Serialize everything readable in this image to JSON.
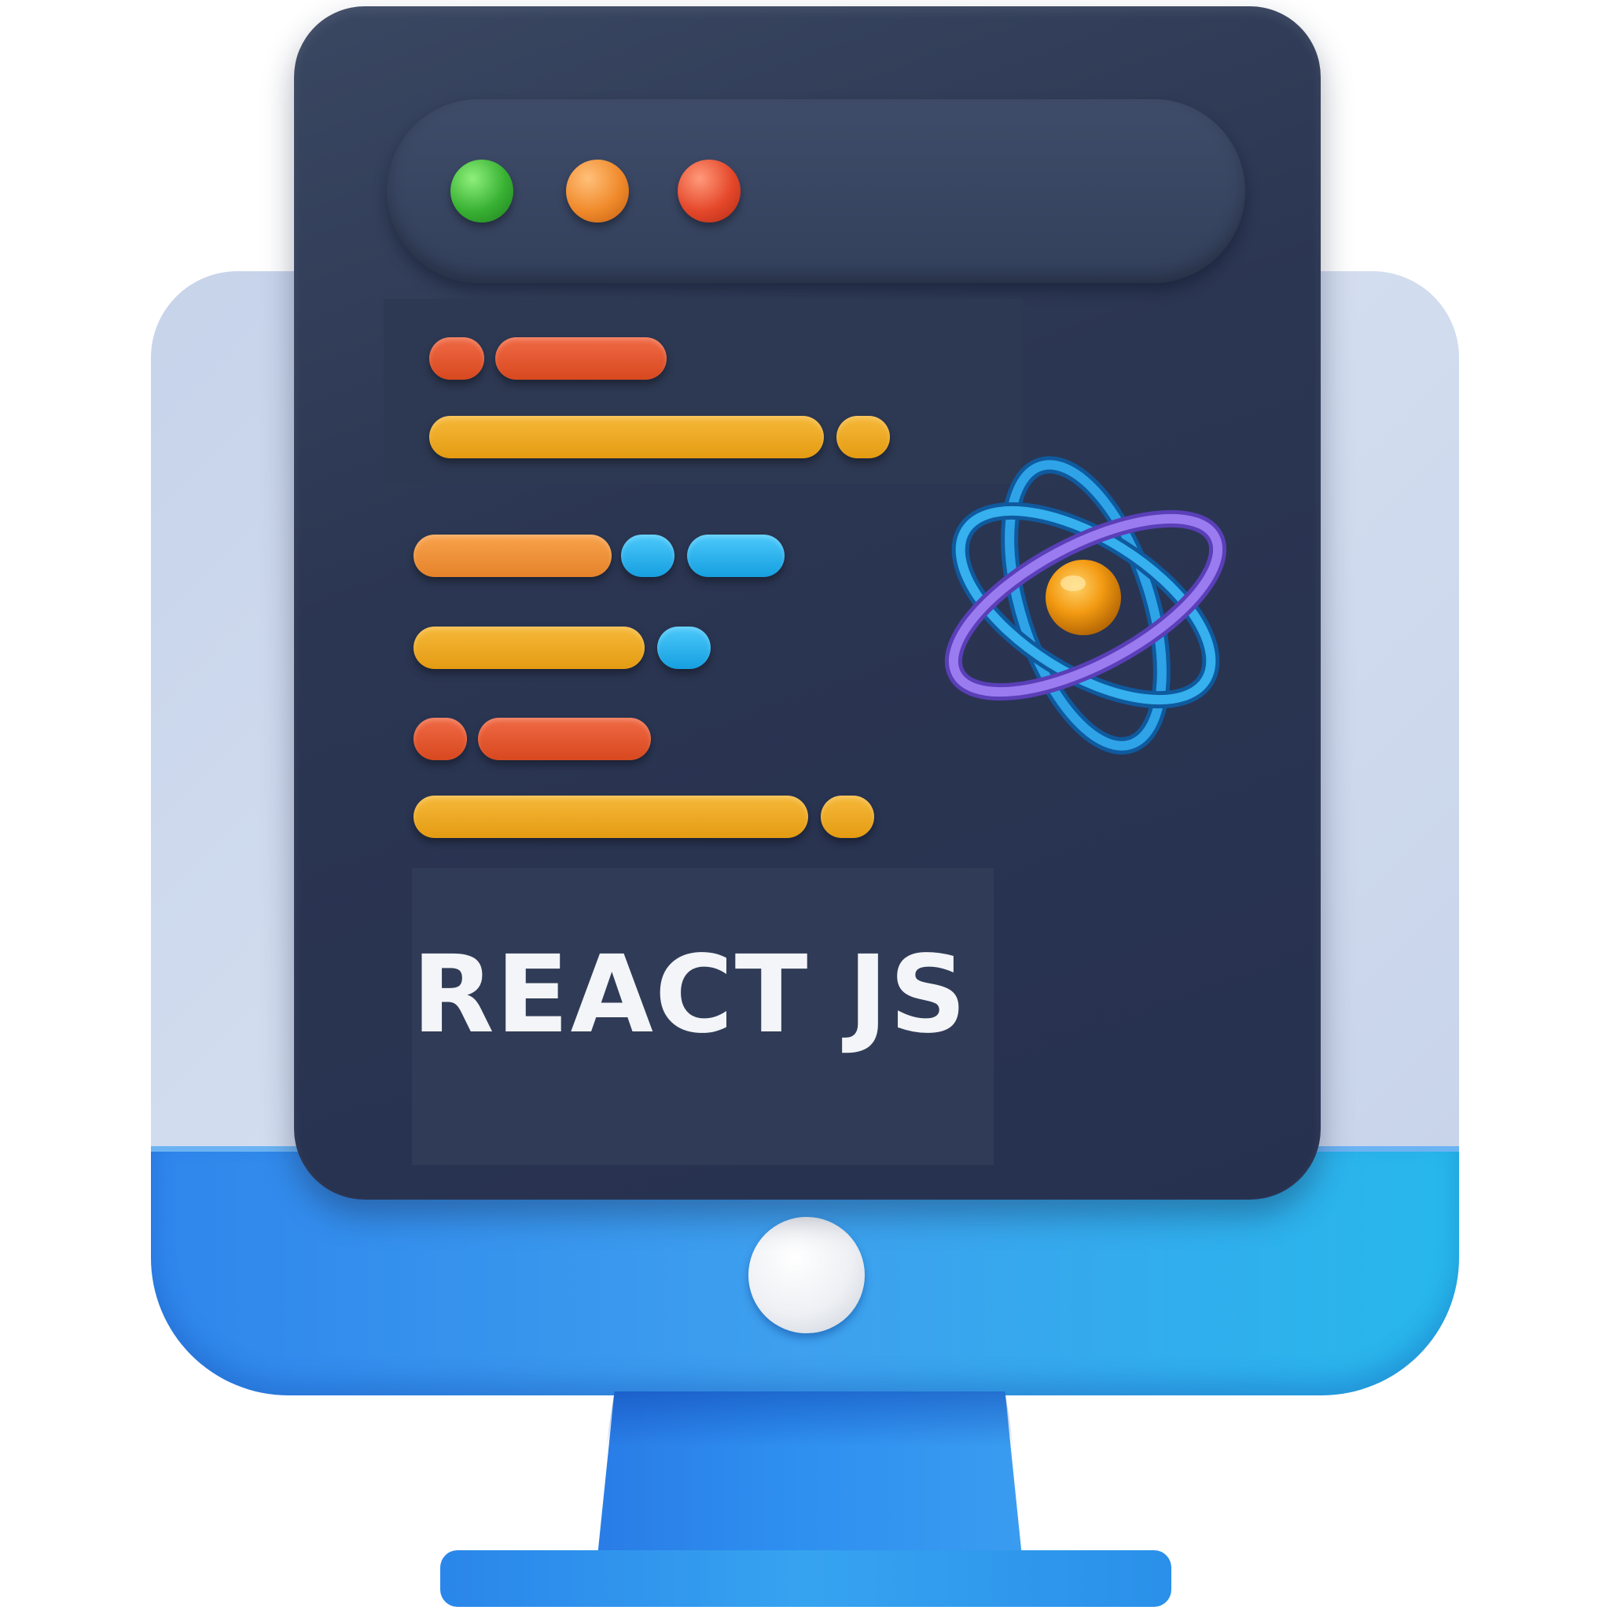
{
  "label": {
    "text": "REACT JS"
  },
  "window_controls": {
    "green_color": "#38b133",
    "orange_color": "#f08a2b",
    "red_color": "#e5472a"
  },
  "icons": {
    "atom": "atom-icon",
    "power": "power-button-icon"
  },
  "colors": {
    "panel": "#2b3652",
    "monitor_blue": "#2f86ec",
    "monitor_back": "#c6d3ea",
    "code_red": "#e5472a",
    "code_yellow": "#e9a51b",
    "code_orange": "#ee8f34",
    "code_blue": "#22b2ef",
    "text": "#f3f5f8"
  }
}
